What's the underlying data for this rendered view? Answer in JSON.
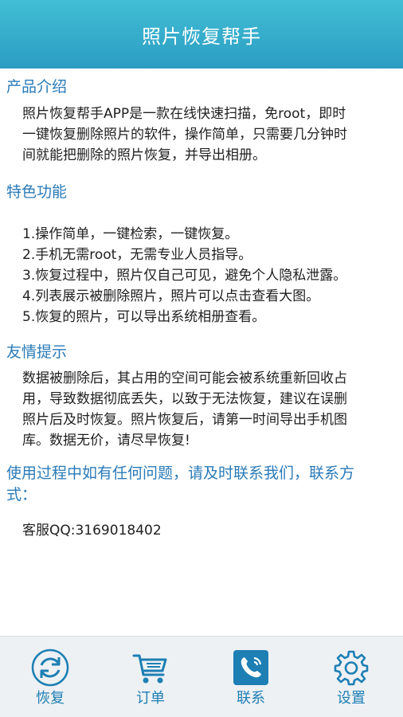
{
  "header": {
    "title": "照片恢复帮手"
  },
  "sections": {
    "intro": {
      "title": "产品介绍",
      "lines": [
        "照片恢复帮手APP是一款在线快速扫描，免root，即时",
        "一键恢复删除照片的软件，操作简单，只需要几分钟时",
        "间就能把删除的照片恢复，并导出相册。"
      ]
    },
    "features": {
      "title": "特色功能",
      "lines": [
        "1.操作简单，一键检索，一键恢复。",
        "2.手机无需root，无需专业人员指导。",
        "3.恢复过程中，照片仅自己可见，避免个人隐私泄露。",
        "4.列表展示被删除照片，照片可以点击查看大图。",
        "5.恢复的照片，可以导出系统相册查看。"
      ]
    },
    "tips": {
      "title": "友情提示",
      "lines": [
        "数据被删除后，其占用的空间可能会被系统重新回收占",
        "用，导致数据彻底丢失，以致于无法恢复，建议在误删",
        "照片后及时恢复。照片恢复后，请第一时间导出手机图",
        "库。数据无价，请尽早恢复!"
      ]
    },
    "contact": {
      "title_lines": [
        "使用过程中如有任何问题，请及时联系我们，联系方",
        "式："
      ],
      "qq": "客服QQ:3169018402"
    }
  },
  "tabbar": {
    "tabs": [
      {
        "label": "恢复",
        "icon": "refresh-icon"
      },
      {
        "label": "订单",
        "icon": "cart-icon"
      },
      {
        "label": "联系",
        "icon": "phone-icon",
        "active": true
      },
      {
        "label": "设置",
        "icon": "gear-icon"
      }
    ]
  },
  "colors": {
    "header_top": "#41bfd5",
    "header_bottom": "#2c9cc2",
    "section_title": "#2a7bb8",
    "tab_accent": "#1d7fb4"
  }
}
